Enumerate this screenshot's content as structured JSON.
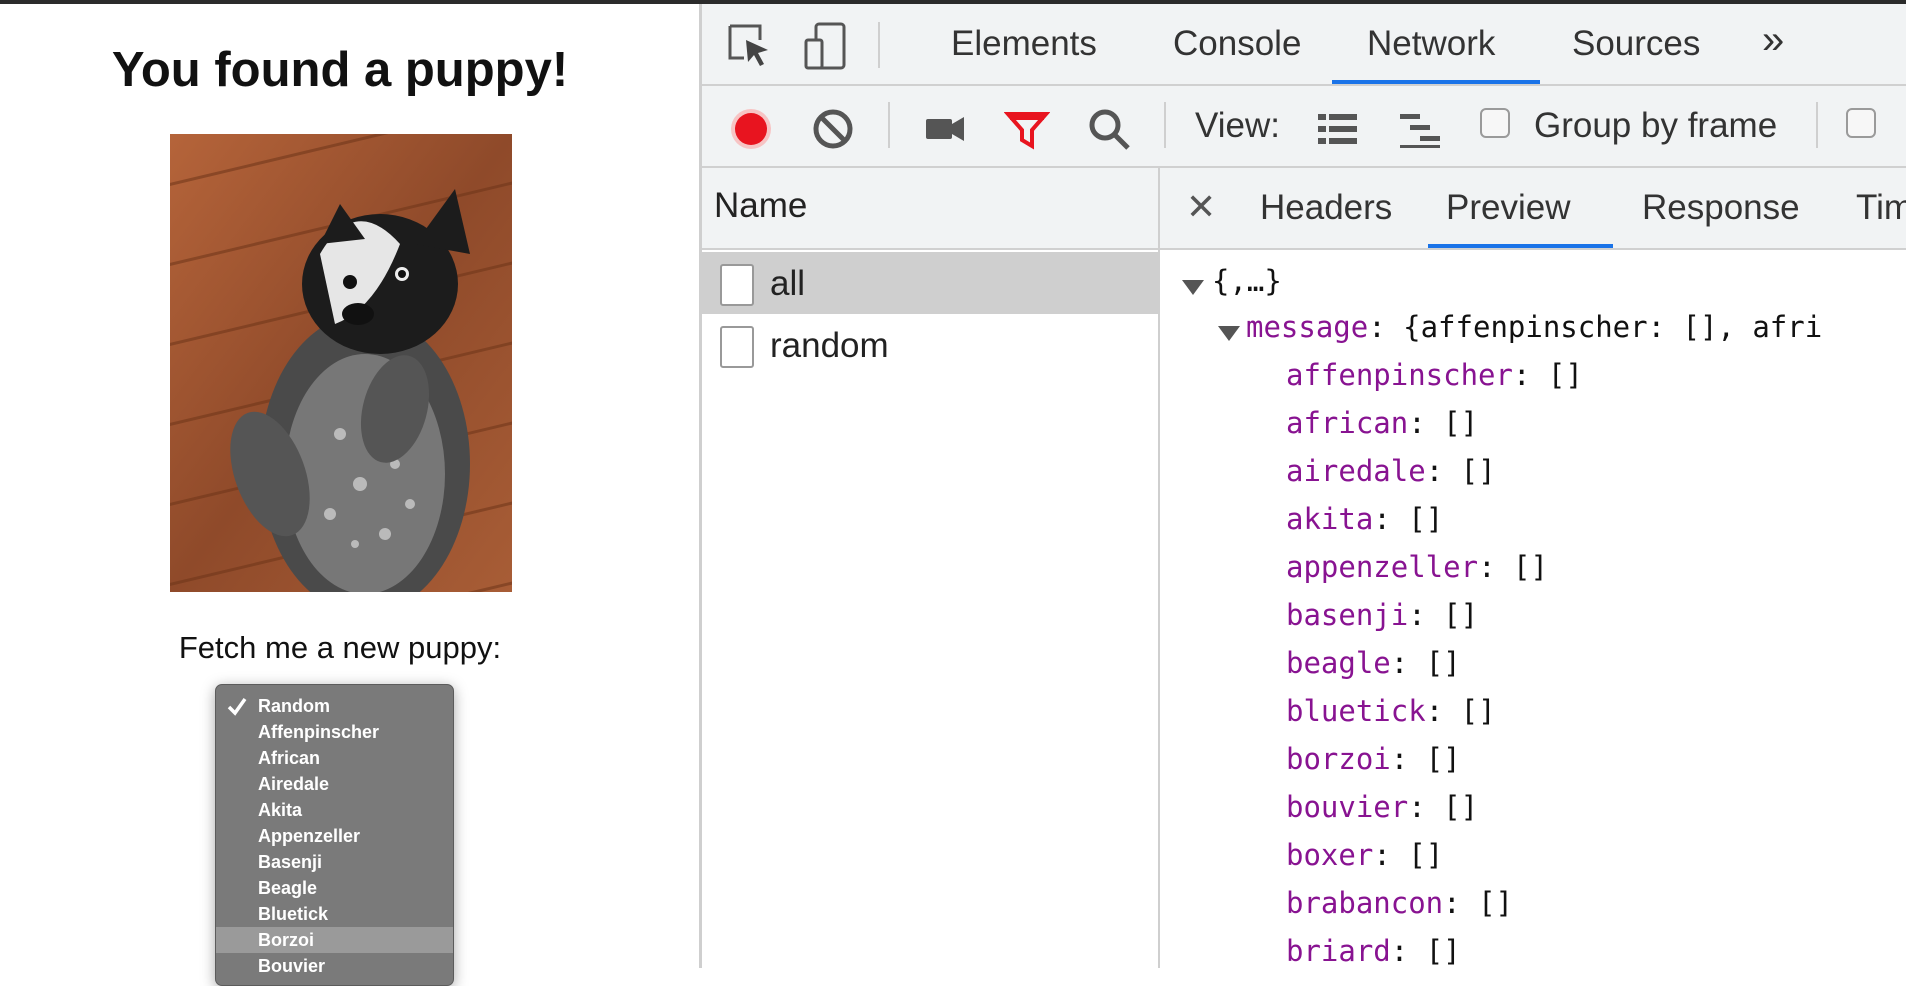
{
  "page": {
    "title": "You found a puppy!",
    "fetch_label": "Fetch me a new puppy:",
    "dropdown": {
      "selected": "Random",
      "highlighted": "Borzoi",
      "options": [
        "Random",
        "Affenpinscher",
        "African",
        "Airedale",
        "Akita",
        "Appenzeller",
        "Basenji",
        "Beagle",
        "Bluetick",
        "Borzoi",
        "Bouvier"
      ]
    }
  },
  "devtools": {
    "tabs": [
      "Elements",
      "Console",
      "Network",
      "Sources"
    ],
    "active_tab": "Network",
    "more_tabs": "»",
    "toolbar": {
      "view_label": "View:",
      "group_by_frame": "Group by frame"
    },
    "name_column": {
      "header": "Name",
      "requests": [
        "all",
        "random"
      ],
      "selected_request": "all"
    },
    "detail_tabs": [
      "Headers",
      "Preview",
      "Response",
      "Tim"
    ],
    "active_detail_tab": "Preview",
    "preview": {
      "root": "{,…}",
      "message_key": "message",
      "message_summary": "{affenpinscher: [], afri",
      "entries": [
        {
          "key": "affenpinscher",
          "value": "[]"
        },
        {
          "key": "african",
          "value": "[]"
        },
        {
          "key": "airedale",
          "value": "[]"
        },
        {
          "key": "akita",
          "value": "[]"
        },
        {
          "key": "appenzeller",
          "value": "[]"
        },
        {
          "key": "basenji",
          "value": "[]"
        },
        {
          "key": "beagle",
          "value": "[]"
        },
        {
          "key": "bluetick",
          "value": "[]"
        },
        {
          "key": "borzoi",
          "value": "[]"
        },
        {
          "key": "bouvier",
          "value": "[]"
        },
        {
          "key": "boxer",
          "value": "[]"
        },
        {
          "key": "brabancon",
          "value": "[]"
        },
        {
          "key": "briard",
          "value": "[]"
        }
      ]
    }
  },
  "colors": {
    "accent": "#1a73e8",
    "record": "#e8141f",
    "filter": "#e8141f",
    "json_key": "#881391"
  }
}
